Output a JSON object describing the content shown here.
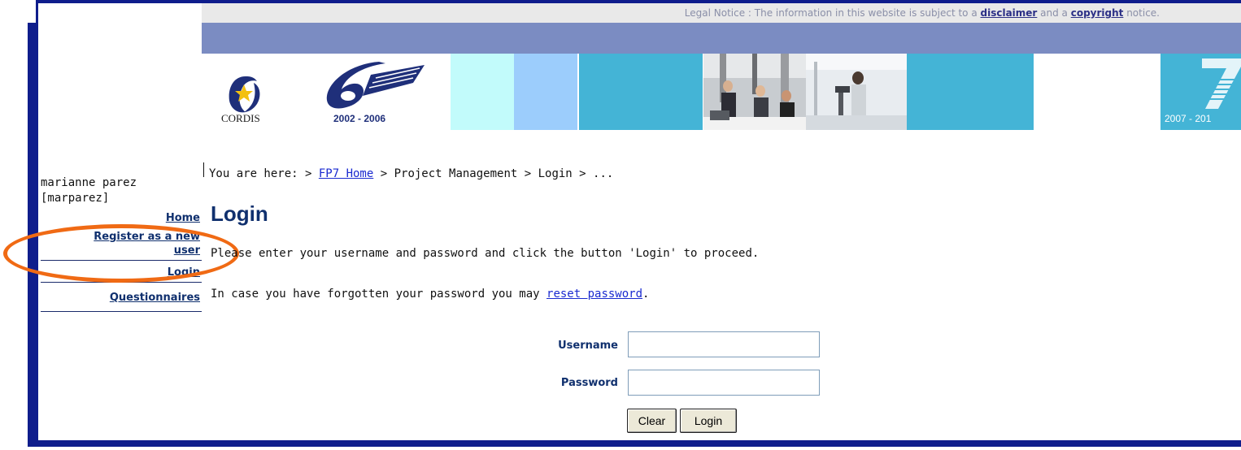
{
  "legal": {
    "prefix": "Legal Notice : The information in this website is subject to a ",
    "disclaimer": "disclaimer",
    "middle": " and a ",
    "copyright": "copyright",
    "suffix": " notice."
  },
  "banner": {
    "cordis": "CORDIS",
    "fp6_years": "2002 - 2006",
    "fp7_years": "2007 - 201"
  },
  "user": {
    "name": "marianne parez",
    "login": "[marparez]"
  },
  "nav": {
    "home": "Home",
    "register_line1": "Register as a new",
    "register_line2": "user",
    "login": "Login",
    "questionnaires": "Questionnaires"
  },
  "breadcrumb": {
    "prefix": "You are here: > ",
    "home_link": "FP7 Home",
    "rest": " > Project Management > Login > ..."
  },
  "page": {
    "title": "Login",
    "instruction": "Please enter your username and password and click the button 'Login' to proceed.",
    "forgot_prefix": "In case you have forgotten your password you may ",
    "reset_link": "reset password",
    "forgot_suffix": "."
  },
  "form": {
    "username_label": "Username",
    "password_label": "Password",
    "username_value": "",
    "password_value": "",
    "clear_label": "Clear",
    "login_label": "Login"
  },
  "colors": {
    "frame": "#0f1d8c",
    "annotation": "#f06a14",
    "nav_text": "#10306e",
    "link": "#1a2ad0"
  }
}
